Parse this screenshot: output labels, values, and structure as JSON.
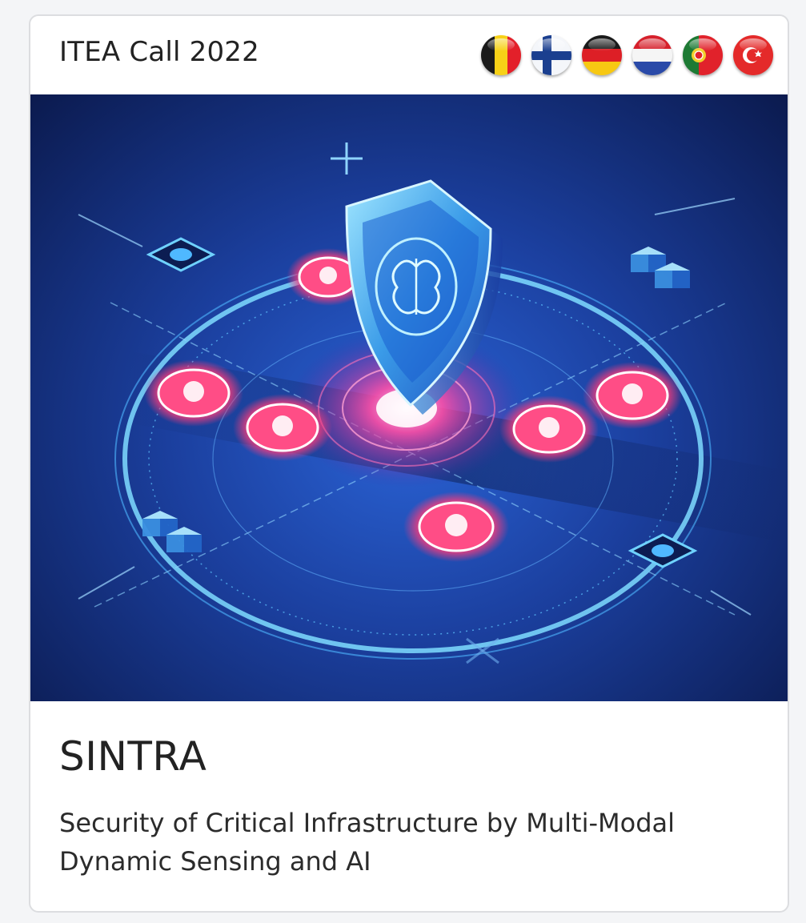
{
  "card": {
    "call_label": "ITEA Call 2022",
    "countries": [
      {
        "code": "BE",
        "icon": "belgium-flag-icon"
      },
      {
        "code": "FI",
        "icon": "finland-flag-icon"
      },
      {
        "code": "DE",
        "icon": "germany-flag-icon"
      },
      {
        "code": "NL",
        "icon": "netherlands-flag-icon"
      },
      {
        "code": "PT",
        "icon": "portugal-flag-icon"
      },
      {
        "code": "TR",
        "icon": "turkey-flag-icon"
      }
    ],
    "image_icon": "cybersecurity-shield-illustration",
    "title": "SINTRA",
    "description": "Security of Critical Infrastructure by Multi-Modal Dynamic Sensing and AI"
  },
  "colors": {
    "card_border": "#dcdde0",
    "text": "#222222",
    "hero_blue": "#1b3f9e",
    "threat_pink": "#ff3b7a"
  }
}
